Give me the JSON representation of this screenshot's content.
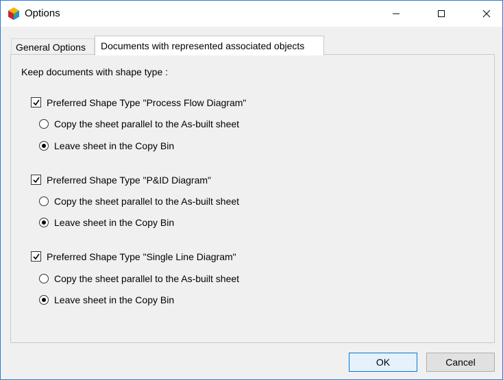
{
  "window": {
    "title": "Options",
    "controls": {
      "minimize": "minimize-icon",
      "maximize": "maximize-icon",
      "close": "close-icon"
    }
  },
  "tabs": [
    {
      "label": "General Options",
      "active": false
    },
    {
      "label": "Documents with represented associated objects",
      "active": true
    }
  ],
  "panel": {
    "keep_label": "Keep documents with shape type :",
    "groups": [
      {
        "checkbox_label": "Preferred Shape Type \"Process Flow Diagram\"",
        "checked": true,
        "option_copy": "Copy the sheet parallel to the As-built sheet",
        "option_leave": "Leave sheet in the Copy Bin",
        "selected": "leave"
      },
      {
        "checkbox_label": "Preferred Shape Type \"P&ID Diagram\"",
        "checked": true,
        "option_copy": "Copy the sheet parallel to the As-built sheet",
        "option_leave": "Leave sheet in the Copy Bin",
        "selected": "leave"
      },
      {
        "checkbox_label": "Preferred Shape Type \"Single Line Diagram\"",
        "checked": true,
        "option_copy": "Copy the sheet parallel to the As-built sheet",
        "option_leave": "Leave sheet in the Copy Bin",
        "selected": "leave"
      }
    ]
  },
  "buttons": {
    "ok": "OK",
    "cancel": "Cancel"
  },
  "colors": {
    "accent": "#0078d7",
    "window_border": "#2b7ad6"
  }
}
